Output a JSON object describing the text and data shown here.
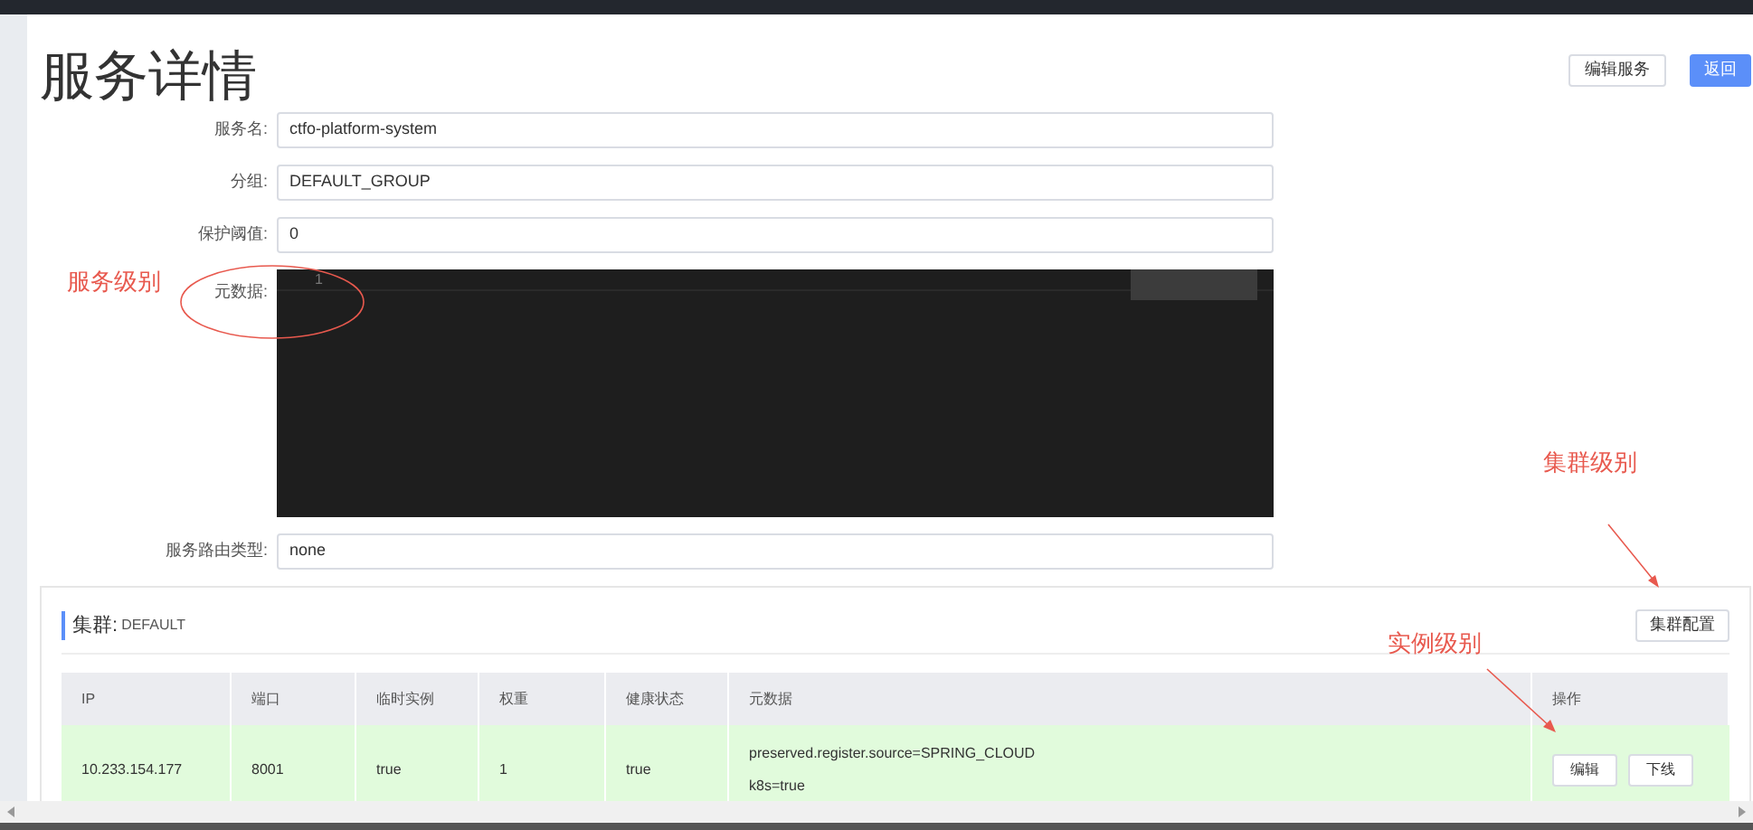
{
  "page": {
    "title": "服务详情",
    "buttons": [
      "编辑服务",
      "返回"
    ]
  },
  "form": {
    "fields": [
      {
        "label": "服务名:",
        "value": "ctfo-platform-system"
      },
      {
        "label": "分组:",
        "value": "DEFAULT_GROUP"
      },
      {
        "label": "保护阈值:",
        "value": "0"
      }
    ],
    "metadata": {
      "label": "元数据:",
      "line_numbers": [
        "1"
      ]
    },
    "route": {
      "label": "服务路由类型:",
      "value": "none"
    }
  },
  "cluster": {
    "label": "集群:",
    "name": "DEFAULT",
    "config_button": "集群配置",
    "columns": [
      "IP",
      "端口",
      "临时实例",
      "权重",
      "健康状态",
      "元数据",
      "操作"
    ],
    "rows": [
      {
        "ip": "10.233.154.177",
        "port": "8001",
        "ephemeral": "true",
        "weight": "1",
        "healthy": "true",
        "metadata": [
          "preserved.register.source=SPRING_CLOUD",
          "k8s=true"
        ],
        "actions": [
          "编辑",
          "下线"
        ]
      }
    ]
  },
  "annotations": [
    "服务级别",
    "集群级别",
    "实例级别"
  ]
}
